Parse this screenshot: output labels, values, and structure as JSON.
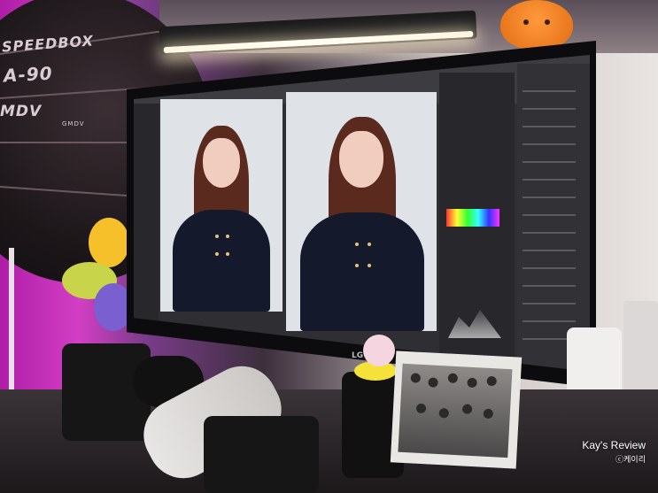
{
  "scene": {
    "softbox": {
      "brand": "SPEEDBOX",
      "model": "A-90",
      "maker": "MDV",
      "small": "GMDV"
    },
    "monitor_brand": "LG"
  },
  "watermark": {
    "title": "Kay's Review",
    "credit": "ⓒ케이리"
  },
  "colors": {
    "accent": "#d23fc4",
    "lightbar_glow": "#fffdf3"
  }
}
